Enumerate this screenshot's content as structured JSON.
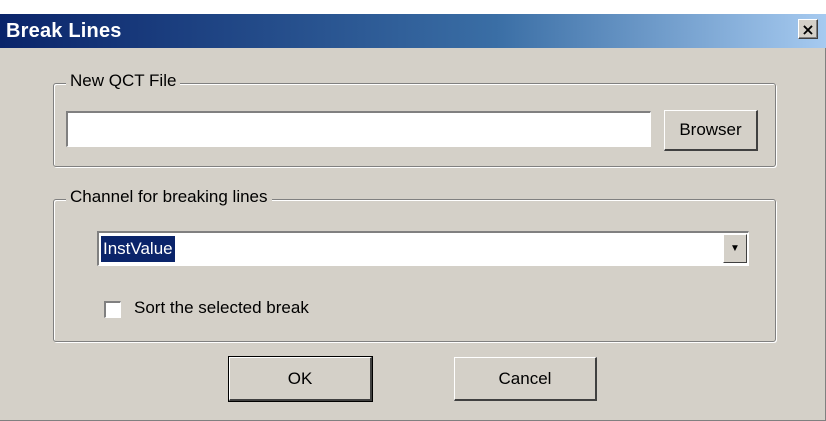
{
  "window": {
    "title": "Break Lines",
    "close_symbol": "×"
  },
  "new_qct_file": {
    "group_label": "New QCT File",
    "path_value": "",
    "browse_label": "Browser"
  },
  "channel": {
    "group_label": "Channel for breaking lines",
    "selected_value": "InstValue",
    "arrow_symbol": "▼",
    "sort_label": "Sort the selected break",
    "sort_checked": false
  },
  "actions": {
    "ok_label": "OK",
    "cancel_label": "Cancel"
  }
}
